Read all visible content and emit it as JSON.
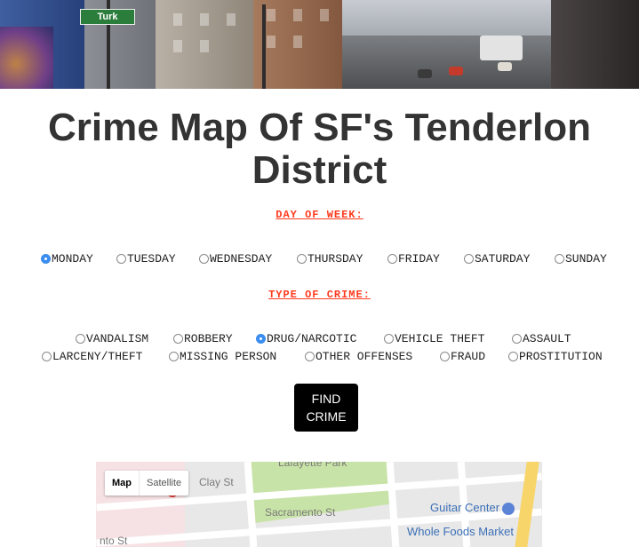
{
  "banner": {
    "street_sign": "Turk"
  },
  "title": {
    "line1": "Crime Map Of SF's Tenderlon",
    "line2": "District"
  },
  "day_of_week": {
    "label": "DAY OF WEEK:",
    "options": [
      "MONDAY",
      "TUESDAY",
      "WEDNESDAY",
      "THURSDAY",
      "FRIDAY",
      "SATURDAY",
      "SUNDAY"
    ],
    "selected": "MONDAY"
  },
  "crime_type": {
    "label": "TYPE OF CRIME:",
    "row1": [
      "VANDALISM",
      "ROBBERY",
      "DRUG/NARCOTIC",
      "VEHICLE THEFT",
      "ASSAULT"
    ],
    "row2": [
      "LARCENY/THEFT",
      "MISSING PERSON",
      "OTHER OFFENSES",
      "FRAUD",
      "PROSTITUTION"
    ],
    "selected": "DRUG/NARCOTIC"
  },
  "find_button": {
    "line1": "FIND",
    "line2": "CRIME"
  },
  "map": {
    "type_map": "Map",
    "type_satellite": "Satellite",
    "labels": {
      "lafayette_park": "Lafayette Park",
      "clay_st": "Clay St",
      "sacramento_st": "Sacramento St",
      "partial_st": "nto St"
    },
    "poi": {
      "guitar_center": "Guitar Center",
      "whole_foods": "Whole Foods Market"
    }
  }
}
